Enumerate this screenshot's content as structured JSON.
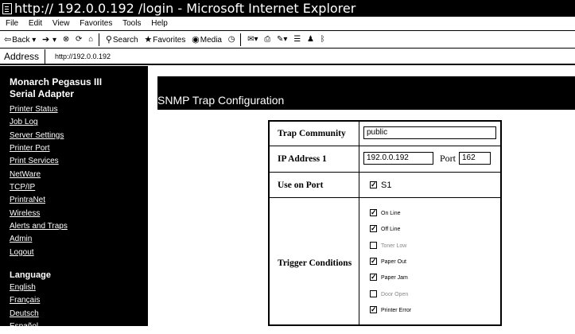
{
  "window": {
    "title": "http:// 192.0.0.192  /login - Microsoft Internet Explorer"
  },
  "menu": [
    "File",
    "Edit",
    "View",
    "Favorites",
    "Tools",
    "Help"
  ],
  "toolbar": {
    "back": "Back",
    "search": "Search",
    "favorites": "Favorites",
    "media": "Media"
  },
  "address": {
    "label": "Address",
    "url": "http://192.0.0.192"
  },
  "sidebar": {
    "title_line1": "Monarch Pegasus III",
    "title_line2": "Serial Adapter",
    "links": [
      "Printer Status",
      "Job Log",
      "Server Settings",
      "Printer Port",
      "Print Services",
      "NetWare",
      "TCP/IP",
      "PrintraNet",
      "Wireless",
      "Alerts and Traps",
      "Admin",
      "Logout"
    ],
    "language_title": "Language",
    "languages": [
      "English",
      "Français",
      "Deutsch",
      "Español"
    ]
  },
  "page": {
    "title": "SNMP Trap Configuration"
  },
  "form": {
    "trap_community_label": "Trap Community",
    "trap_community_value": "public",
    "ip_address_label": "IP Address 1",
    "ip_address_value": "192.0.0.192",
    "port_label": "Port",
    "port_value": "162",
    "use_on_port_label": "Use on Port",
    "use_on_port_option": "S1",
    "trigger_label": "Trigger Conditions",
    "triggers": [
      {
        "label": "On Line",
        "checked": true
      },
      {
        "label": "Off Line",
        "checked": true
      },
      {
        "label": "Toner Low",
        "checked": false
      },
      {
        "label": "Paper Out",
        "checked": true
      },
      {
        "label": "Paper Jam",
        "checked": true
      },
      {
        "label": "Door Open",
        "checked": false
      },
      {
        "label": "Printer Error",
        "checked": true
      }
    ]
  }
}
